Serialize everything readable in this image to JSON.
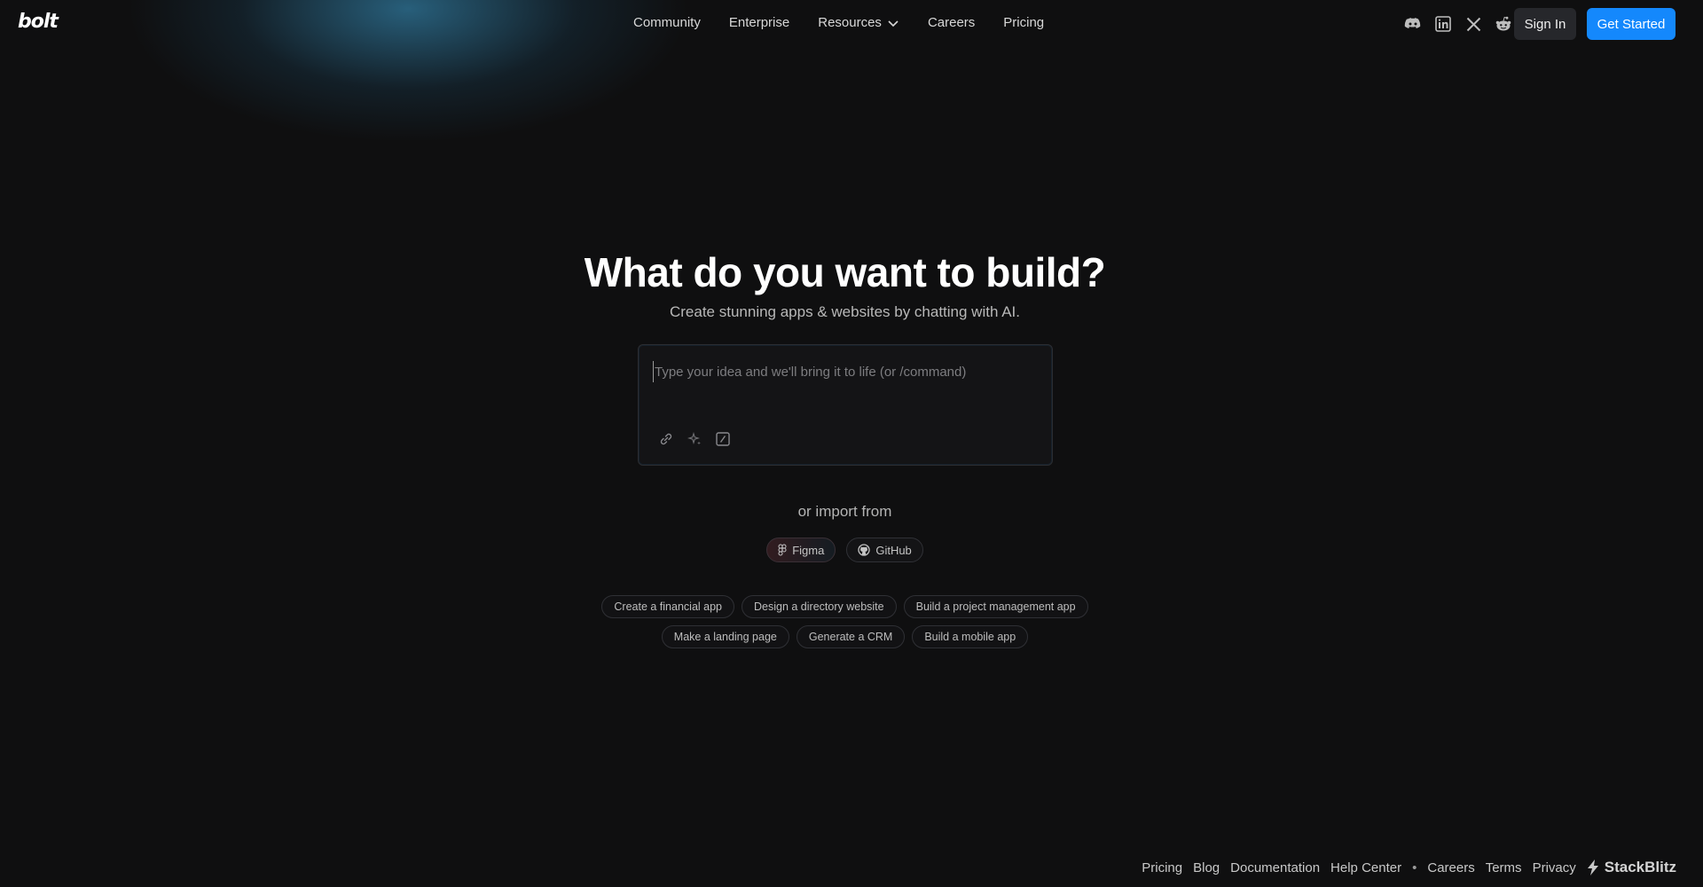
{
  "brand": {
    "logo_text": "bolt"
  },
  "nav": {
    "items": [
      "Community",
      "Enterprise",
      "Resources",
      "Careers",
      "Pricing"
    ]
  },
  "social_icons": [
    "discord-icon",
    "linkedin-icon",
    "x-icon",
    "reddit-icon"
  ],
  "header": {
    "sign_in_label": "Sign In",
    "get_started_label": "Get Started"
  },
  "hero": {
    "title": "What do you want to build?",
    "subtitle": "Create stunning apps & websites by chatting with AI."
  },
  "prompt": {
    "placeholder": "Type your idea and we'll bring it to life (or /command)",
    "value": "",
    "tools": [
      "link-icon",
      "sparkle-icon",
      "command-icon"
    ]
  },
  "import": {
    "label": "or import from",
    "sources": [
      "Figma",
      "GitHub"
    ]
  },
  "suggestions": {
    "row1": [
      "Create a financial app",
      "Design a directory website",
      "Build a project management app"
    ],
    "row2": [
      "Make a landing page",
      "Generate a CRM",
      "Build a mobile app"
    ]
  },
  "footer": {
    "links_left": [
      "Pricing",
      "Blog",
      "Documentation",
      "Help Center"
    ],
    "separator": "•",
    "links_right": [
      "Careers",
      "Terms",
      "Privacy"
    ],
    "brand": "StackBlitz"
  },
  "colors": {
    "background": "#0f0f10",
    "accent": "#1488fc",
    "glow": "#3ca0d2"
  }
}
